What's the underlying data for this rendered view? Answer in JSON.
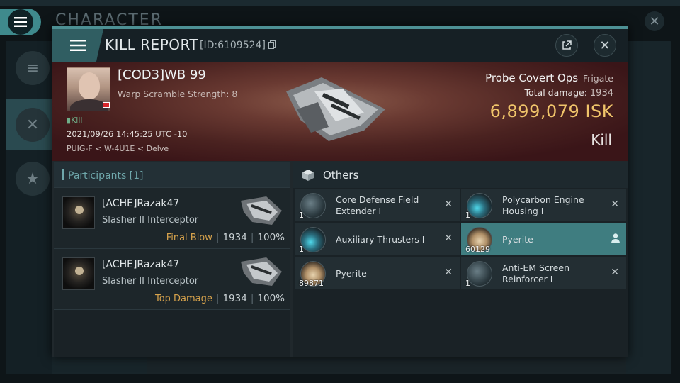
{
  "background": {
    "title": "CHARACTER",
    "close_glyph": "✕"
  },
  "modal": {
    "title": "KILL REPORT",
    "report_id": "[ID:6109524]",
    "close_glyph": "✕",
    "icons": {
      "menu": "hamburger-menu-icon",
      "external": "external-link-icon",
      "copy": "copy-icon"
    }
  },
  "victim": {
    "name": "[COD3]WB 99",
    "warp_scramble": "Warp Scramble Strength: 8",
    "kill_tag": "Kill",
    "date": "2021/09/26 14:45:25 UTC -10",
    "location": "PUIG-F < W-4U1E < Delve",
    "ship_name": "Probe Covert Ops",
    "ship_class": "Frigate",
    "total_damage_label": "Total damage:",
    "total_damage": "1934",
    "isk_value": "6,899,079",
    "isk_unit": "ISK",
    "result": "Kill"
  },
  "participants": {
    "header": "Participants [1]",
    "rows": [
      {
        "name": "[ACHE]Razak47",
        "ship": "Slasher II Interceptor",
        "tag": "Final Blow",
        "damage": "1934",
        "percent": "100%"
      },
      {
        "name": "[ACHE]Razak47",
        "ship": "Slasher II Interceptor",
        "tag": "Top Damage",
        "damage": "1934",
        "percent": "100%"
      }
    ]
  },
  "others": {
    "header": "Others",
    "items": [
      {
        "name": "Core Defense Field Extender I",
        "qty": "1",
        "icon": "shield-module-icon"
      },
      {
        "name": "Polycarbon Engine Housing I",
        "qty": "1",
        "icon": "engine-module-icon"
      },
      {
        "name": "Auxiliary Thrusters I",
        "qty": "1",
        "icon": "thruster-module-icon"
      },
      {
        "name": "Pyerite",
        "qty": "60129",
        "icon": "ore-icon",
        "selected": true
      },
      {
        "name": "Pyerite",
        "qty": "89871",
        "icon": "ore-icon"
      },
      {
        "name": "Anti-EM Screen Reinforcer I",
        "qty": "1",
        "icon": "shield-module-icon"
      }
    ]
  },
  "colors": {
    "accent": "#4d9094",
    "isk": "#f0c46a",
    "tag": "#d6a24c",
    "selected_item": "#3f7d80"
  }
}
